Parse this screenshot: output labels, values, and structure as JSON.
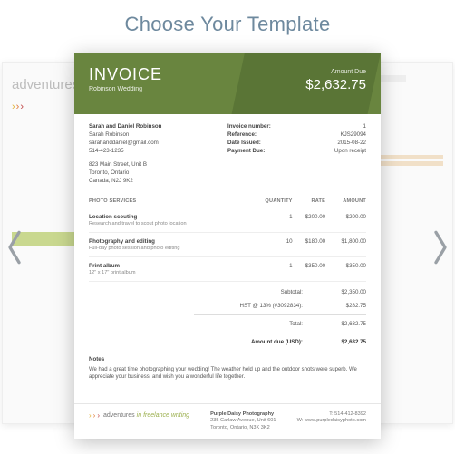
{
  "page": {
    "heading": "Choose Your Template"
  },
  "sideLeft": {
    "brand": "adventures"
  },
  "invoice": {
    "title": "INVOICE",
    "subtitle": "Robinson Wedding",
    "amountDueLabel": "Amount Due",
    "amountDue": "$2,632.75",
    "billTo": {
      "line1": "Sarah and Daniel Robinson",
      "line2": "Sarah Robinson",
      "email": "sarahanddaniel@gmail.com",
      "phone": "514-423-1235",
      "addr1": "823 Main Street, Unit B",
      "addr2": "Toronto, Ontario",
      "addr3": "Canada, N2J 9K2"
    },
    "meta": {
      "invoiceNumLabel": "Invoice number:",
      "invoiceNum": "1",
      "referenceLabel": "Reference:",
      "reference": "KJS29094",
      "dateIssuedLabel": "Date Issued:",
      "dateIssued": "2015-08-22",
      "paymentDueLabel": "Payment Due:",
      "paymentDue": "Upon receipt"
    },
    "table": {
      "colService": "PHOTO SERVICES",
      "colQty": "QUANTITY",
      "colRate": "RATE",
      "colAmount": "AMOUNT"
    },
    "items": [
      {
        "name": "Location scouting",
        "desc": "Research and travel to scout photo location",
        "qty": "1",
        "rate": "$200.00",
        "amount": "$200.00"
      },
      {
        "name": "Photography and editing",
        "desc": "Full-day photo session and photo editing",
        "qty": "10",
        "rate": "$180.00",
        "amount": "$1,800.00"
      },
      {
        "name": "Print album",
        "desc": "12\" x 17\" print album",
        "qty": "1",
        "rate": "$350.00",
        "amount": "$350.00"
      }
    ],
    "totals": {
      "subtotalLabel": "Subtotal:",
      "subtotal": "$2,350.00",
      "taxLabel": "HST @ 13% (#3092834):",
      "tax": "$282.75",
      "totalLabel": "Total:",
      "total": "$2,632.75",
      "dueLabel": "Amount due (USD):",
      "due": "$2,632.75"
    },
    "notes": {
      "title": "Notes",
      "body": "We had a great time photographing your wedding! The weather held up and the outdoor shots were superb. We appreciate your business, and wish you a wonderful life together."
    },
    "footer": {
      "brandWord": "adventures",
      "brandIn": "in",
      "brandTag": "freelance writing",
      "company": "Purple Daisy Photography",
      "addr1": "235 Carlaw Avenue, Unit 601",
      "addr2": "Toronto, Ontario, N3K 3K2",
      "tel": "T: 514-412-8392",
      "web": "W: www.purpledaisyphoto.com"
    }
  }
}
